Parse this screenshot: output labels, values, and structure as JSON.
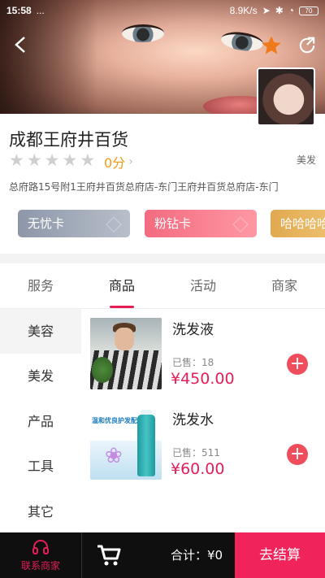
{
  "status_bar": {
    "time": "15:58",
    "dots": "...",
    "network_speed": "8.9K/s",
    "battery": "70"
  },
  "header": {
    "back_icon": "chevron-left-icon",
    "favorite_icon": "star-icon",
    "share_icon": "share-icon",
    "accent_color": "#f07a1a"
  },
  "shop": {
    "name": "成都王府井百货",
    "rating_stars_filled": 0,
    "rating_stars_total": 5,
    "score": "0分",
    "category": "美发",
    "address": "总府路15号附1王府井百货总府店-东门王府井百货总府店-东门"
  },
  "cards": [
    {
      "label": "无忧卡",
      "color": "#9aa2b1"
    },
    {
      "label": "粉钻卡",
      "color": "#f8788a"
    },
    {
      "label": "哈哈哈哈",
      "color": "#e7b262"
    }
  ],
  "tabs": [
    {
      "label": "服务",
      "active": false
    },
    {
      "label": "商品",
      "active": true
    },
    {
      "label": "活动",
      "active": false
    },
    {
      "label": "商家",
      "active": false
    }
  ],
  "categories": [
    {
      "label": "美容",
      "active": false
    },
    {
      "label": "美发",
      "active": true
    },
    {
      "label": "产品",
      "active": true
    },
    {
      "label": "工具",
      "active": true
    },
    {
      "label": "其它",
      "active": true
    }
  ],
  "products": [
    {
      "name": "洗发液",
      "sold": "已售：18",
      "price": "¥450.00"
    },
    {
      "name": "洗发水",
      "sold": "已售：511",
      "price": "¥60.00",
      "image_text": "温和优良护发配方"
    }
  ],
  "bottom_bar": {
    "contact_label": "联系商家",
    "total": "合计：¥0",
    "checkout_label": "去结算",
    "brand_color": "#f0245b"
  }
}
